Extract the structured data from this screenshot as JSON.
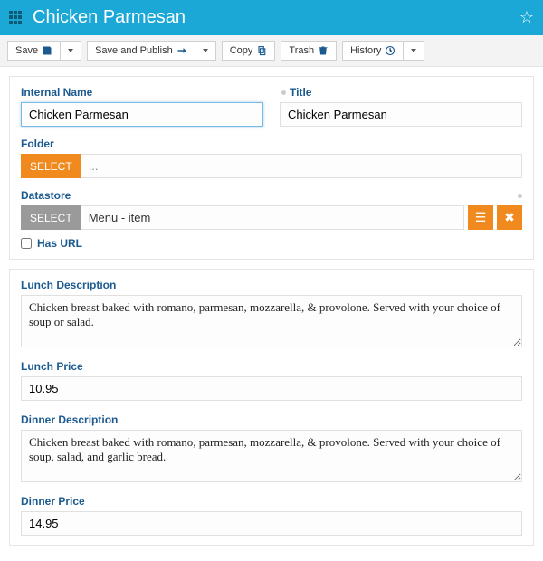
{
  "header": {
    "title": "Chicken Parmesan"
  },
  "toolbar": {
    "save": "Save",
    "save_publish": "Save and Publish",
    "copy": "Copy",
    "trash": "Trash",
    "history": "History"
  },
  "labels": {
    "internal_name": "Internal Name",
    "title": "Title",
    "folder": "Folder",
    "datastore": "Datastore",
    "has_url": "Has URL",
    "lunch_desc": "Lunch Description",
    "lunch_price": "Lunch Price",
    "dinner_desc": "Dinner Description",
    "dinner_price": "Dinner Price",
    "select": "SELECT"
  },
  "values": {
    "internal_name": "Chicken Parmesan",
    "title": "Chicken Parmesan",
    "folder_trail": "...",
    "datastore": "Menu - item",
    "lunch_desc": "Chicken breast baked with romano, parmesan, mozzarella, & provolone. Served with your choice of soup or salad.",
    "lunch_price": "10.95",
    "dinner_desc": "Chicken breast baked with romano, parmesan, mozzarella, & provolone. Served with your choice of soup, salad, and garlic bread.",
    "dinner_price": "14.95"
  }
}
